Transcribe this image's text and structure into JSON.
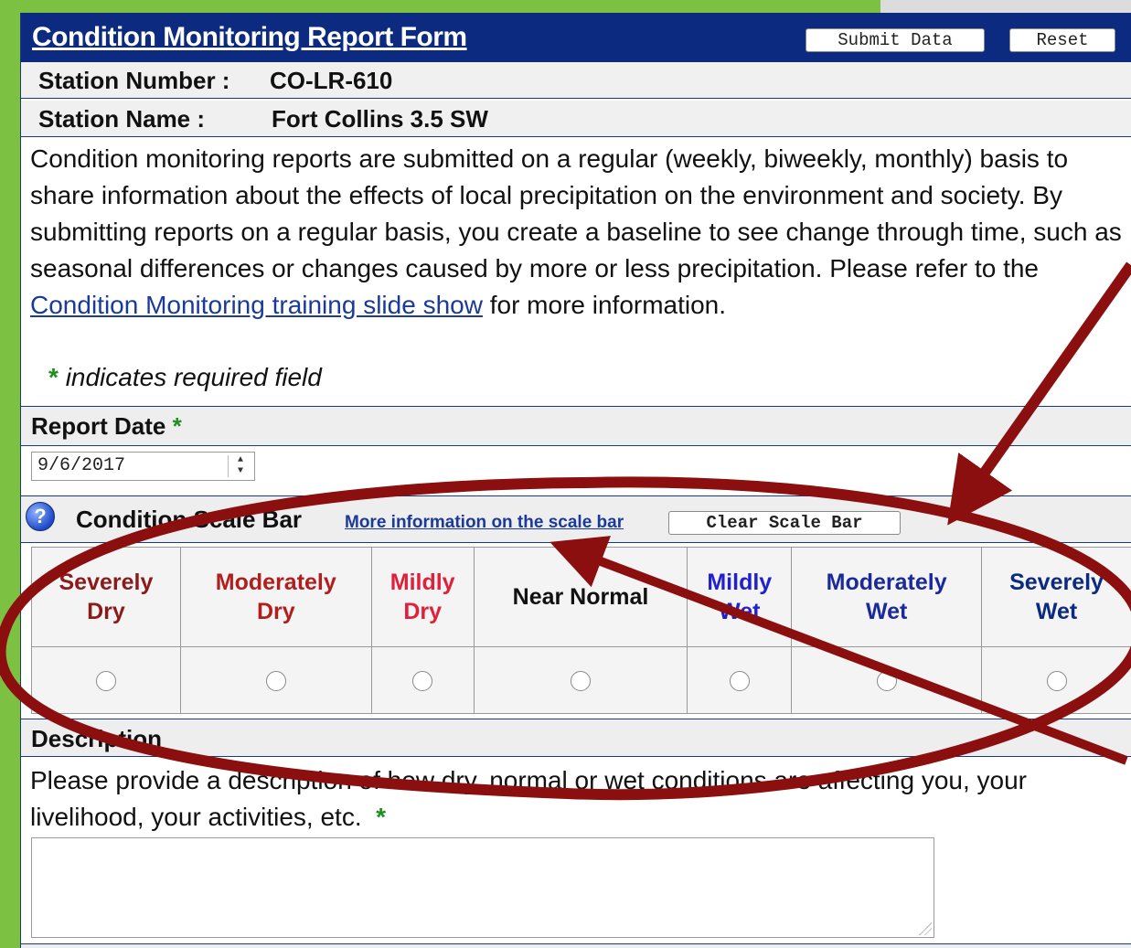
{
  "form": {
    "title": "Condition Monitoring Report Form",
    "submit_label": "Submit Data",
    "reset_label": "Reset"
  },
  "station": {
    "number_label": "Station Number :",
    "number_value": "CO-LR-610",
    "name_label": "Station Name :",
    "name_value": "Fort Collins 3.5 SW"
  },
  "intro": {
    "text_part1": "Condition monitoring reports are submitted on a regular (weekly, biweekly, monthly) basis to share information about the effects of local precipitation on the environment and society. By submitting reports on a regular basis, you create a baseline to see change through time, such as seasonal differences or changes caused by more or less precipitation. Please refer to the ",
    "link_text": "Condition Monitoring training slide show",
    "text_part2": " for more information.",
    "required_star": "*",
    "required_note": "indicates required field"
  },
  "report_date": {
    "label": "Report Date",
    "required_star": "*",
    "value": "9/6/2017"
  },
  "scale_bar": {
    "help_icon": "question-circle-icon",
    "label": "Condition Scale Bar",
    "more_info_link": "More information on the scale bar",
    "clear_label": "Clear Scale Bar",
    "options": [
      {
        "line1": "Severely",
        "line2": "Dry",
        "color": "#8b1a1a"
      },
      {
        "line1": "Moderately",
        "line2": "Dry",
        "color": "#b01e1e"
      },
      {
        "line1": "Mildly",
        "line2": "Dry",
        "color": "#e0203a"
      },
      {
        "line1": "Near Normal",
        "line2": "",
        "color": "#111111"
      },
      {
        "line1": "Mildly",
        "line2": "Wet",
        "color": "#2020d0"
      },
      {
        "line1": "Moderately",
        "line2": "Wet",
        "color": "#1a2a9a"
      },
      {
        "line1": "Severely",
        "line2": "Wet",
        "color": "#0b2a80"
      }
    ]
  },
  "description": {
    "label": "Description",
    "prompt": "Please provide a description of how dry, normal or wet conditions are affecting you, your livelihood, your activities, etc.",
    "required_star": "*",
    "value": ""
  },
  "colors": {
    "header_bg": "#0b2a80",
    "page_green": "#7dc142",
    "annotation_red": "#8b0f0f",
    "link_blue": "#1a3a9a",
    "required_green": "#1f8f1f"
  }
}
